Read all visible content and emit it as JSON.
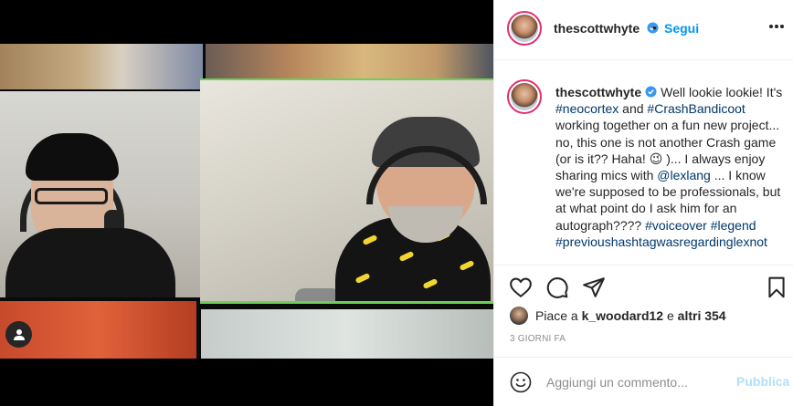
{
  "post": {
    "username": "thescottwhyte",
    "verified": true,
    "follow_separator": "•",
    "follow_label": "Segui"
  },
  "caption": {
    "username": "thescottwhyte",
    "segments": [
      {
        "text": "Well lookie lookie! It's ",
        "type": "text"
      },
      {
        "text": "#neocortex",
        "type": "link"
      },
      {
        "text": " and ",
        "type": "text"
      },
      {
        "text": "#CrashBandicoot",
        "type": "link"
      },
      {
        "text": " working together on a fun new project... no, this one is not another Crash game (or is it?? Haha! 😉 )... I always enjoy sharing mics with ",
        "type": "text"
      },
      {
        "text": "@lexlang",
        "type": "link"
      },
      {
        "text": " ... I know we're supposed to be professionals, but at what point do I ask him for an autograph???? ",
        "type": "text"
      },
      {
        "text": "#voiceover",
        "type": "link"
      },
      {
        "text": " ",
        "type": "text"
      },
      {
        "text": "#legend",
        "type": "link"
      },
      {
        "text": " ",
        "type": "text"
      },
      {
        "text": "#previoushashtagwasregardinglexnot",
        "type": "link"
      }
    ]
  },
  "likes": {
    "prefix": "Piace a ",
    "user": "k_woodard12",
    "middle": " e ",
    "others": "altri 354"
  },
  "timestamp": "3 GIORNI FA",
  "comment": {
    "placeholder": "Aggiungi un commento...",
    "post_label": "Pubblica"
  },
  "icons": {
    "verified": "verified-badge-icon",
    "more": "more-options-icon",
    "like": "heart-icon",
    "comment": "comment-bubble-icon",
    "share": "paper-plane-icon",
    "save": "bookmark-icon",
    "emoji": "smiley-icon",
    "tags": "user-tag-icon"
  },
  "colors": {
    "accent": "#0095f6",
    "link": "#00376b",
    "post_disabled": "#b2dffc",
    "story_ring": "#e1306c",
    "video_frame_border": "#6dcf55"
  }
}
